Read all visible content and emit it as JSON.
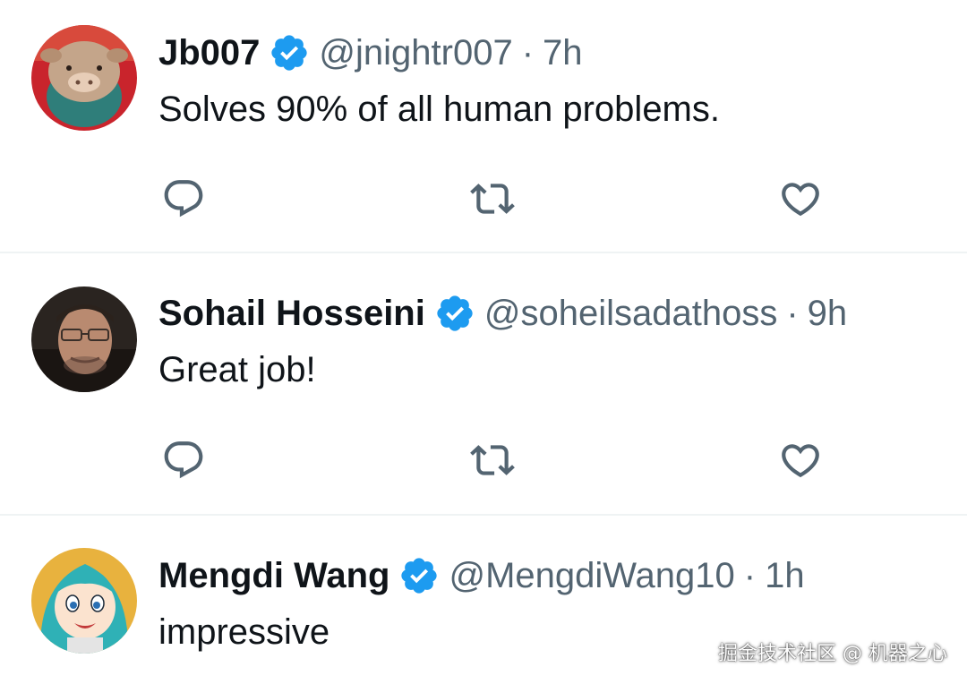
{
  "colors": {
    "verified": "#1d9bf0",
    "secondary_text": "#536471",
    "primary_text": "#0f1419",
    "divider": "#eff3f4"
  },
  "tweets": [
    {
      "name": "Jb007",
      "handle": "@jnightr007",
      "separator": "·",
      "time": "7h",
      "text": "Solves 90% of all human problems.",
      "avatar": "plush-toy-avatar"
    },
    {
      "name": "Sohail Hosseini",
      "handle": "@soheilsadathoss",
      "separator": "·",
      "time": "9h",
      "text": "Great job!",
      "avatar": "man-with-glasses-avatar"
    },
    {
      "name": "Mengdi Wang",
      "handle": "@MengdiWang10",
      "separator": "·",
      "time": "1h",
      "text": "impressive",
      "avatar": "anime-girl-avatar"
    }
  ],
  "icons": {
    "reply": "reply-icon",
    "retweet": "retweet-icon",
    "like": "like-icon",
    "verified": "verified-badge-icon"
  },
  "watermark": "掘金技术社区 @ 机器之心"
}
